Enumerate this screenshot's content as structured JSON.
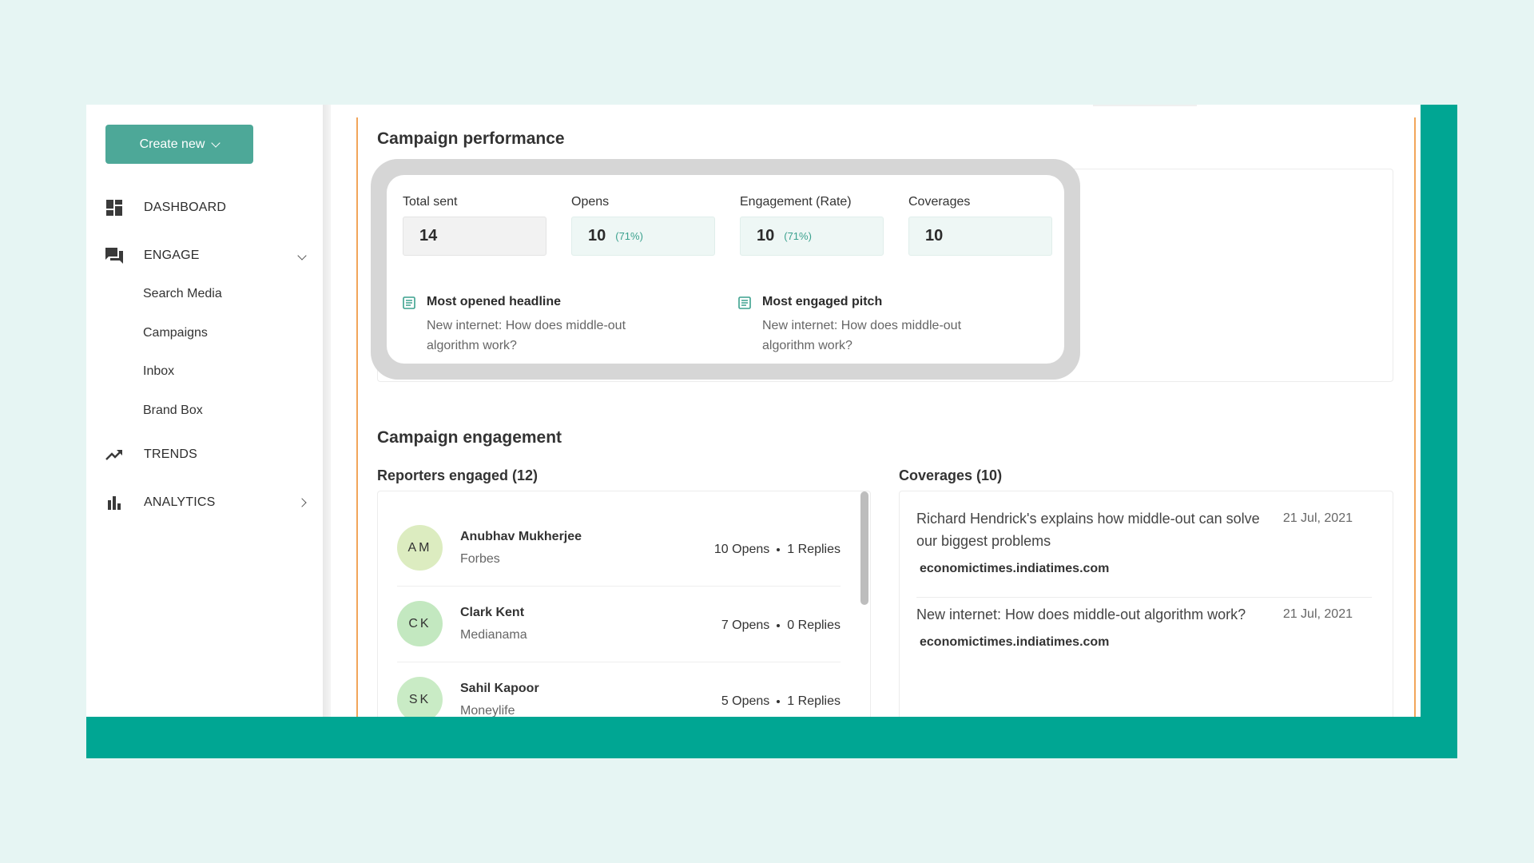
{
  "sidebar": {
    "create_label": "Create new",
    "nav": [
      {
        "label": "DASHBOARD",
        "icon": "dashboard-icon"
      },
      {
        "label": "ENGAGE",
        "icon": "chat-icon"
      },
      {
        "label": "TRENDS",
        "icon": "trending-icon"
      },
      {
        "label": "ANALYTICS",
        "icon": "bar-chart-icon"
      }
    ],
    "engage_items": [
      "Search Media",
      "Campaigns",
      "Inbox",
      "Brand Box"
    ]
  },
  "performance": {
    "title": "Campaign performance",
    "stats": [
      {
        "label": "Total sent",
        "value": "14",
        "pct": ""
      },
      {
        "label": "Opens",
        "value": "10",
        "pct": "(71%)"
      },
      {
        "label": "Engagement (Rate)",
        "value": "10",
        "pct": "(71%)"
      },
      {
        "label": "Coverages",
        "value": "10",
        "pct": ""
      }
    ],
    "most_opened": {
      "title": "Most opened headline",
      "text": "New internet: How does middle-out algorithm work?"
    },
    "most_engaged": {
      "title": "Most engaged pitch",
      "text": "New internet: How does middle-out algorithm work?"
    }
  },
  "engagement": {
    "title": "Campaign engagement",
    "reporters_title": "Reporters engaged (12)",
    "coverages_title": "Coverages (10)",
    "reporters": [
      {
        "initials": "AM",
        "name": "Anubhav Mukherjee",
        "outlet": "Forbes",
        "opens": "10 Opens",
        "replies": "1 Replies"
      },
      {
        "initials": "CK",
        "name": "Clark Kent",
        "outlet": "Medianama",
        "opens": "7 Opens",
        "replies": "0 Replies"
      },
      {
        "initials": "SK",
        "name": "Sahil Kapoor",
        "outlet": "Moneylife",
        "opens": "5 Opens",
        "replies": "1 Replies"
      }
    ],
    "coverages": [
      {
        "title": "Richard Hendrick's explains how middle-out can solve our biggest problems",
        "date": "21 Jul, 2021",
        "source": "economictimes.indiatimes.com"
      },
      {
        "title": "New internet: How does middle-out algorithm work?",
        "date": "21 Jul, 2021",
        "source": "economictimes.indiatimes.com"
      }
    ]
  },
  "colors": {
    "accent": "#4da898",
    "teal_frame": "#00a693",
    "orange_border": "#f2a55a",
    "avatar_am": "#dcecc0",
    "avatar_ck": "#c3e8c0",
    "avatar_sk": "#c9ebc5",
    "stat_box_neutral": "#f2f2f2",
    "stat_box_tinted": "#eef7f5"
  }
}
